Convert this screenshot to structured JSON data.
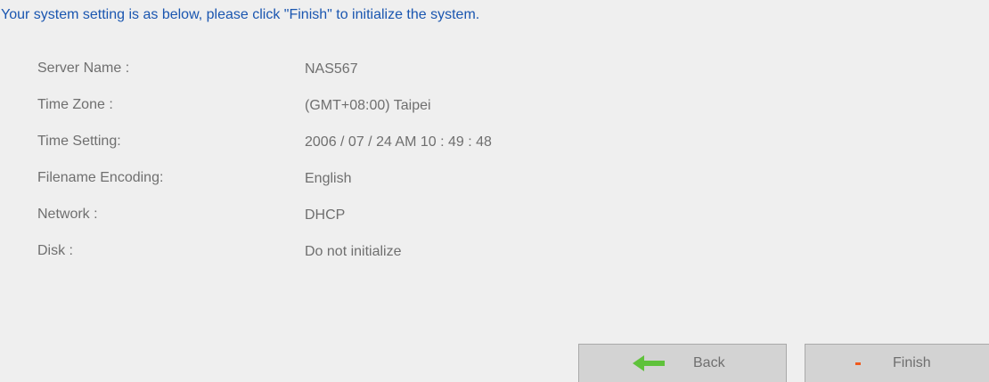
{
  "intro": {
    "text": "Your system setting is as below, please click \"Finish\" to initialize the system."
  },
  "settings": [
    {
      "label": "Server Name :",
      "value": "NAS567"
    },
    {
      "label": "Time Zone :",
      "value": "(GMT+08:00) Taipei"
    },
    {
      "label": "Time Setting:",
      "value": "2006 / 07 / 24 AM 10 : 49 : 48"
    },
    {
      "label": "Filename Encoding:",
      "value": "English"
    },
    {
      "label": "Network :",
      "value": "DHCP"
    },
    {
      "label": "Disk :",
      "value": "Do not initialize"
    }
  ],
  "buttons": {
    "back": {
      "label": "Back",
      "icon": "arrow-left-icon"
    },
    "finish": {
      "label": "Finish",
      "icon": "minus-icon"
    }
  },
  "colors": {
    "intro_text": "#1a56b0",
    "label_text": "#6f6f6f",
    "background": "#efefef",
    "button_bg": "#d3d3d3",
    "back_arrow": "#5fc23b",
    "finish_mark": "#f05a1e"
  }
}
